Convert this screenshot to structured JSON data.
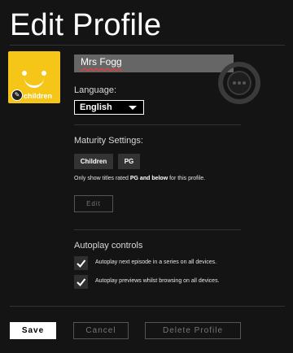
{
  "page": {
    "title": "Edit Profile"
  },
  "profile": {
    "avatar_brand": "children",
    "avatar_color": "#f5c518",
    "name_value": "Mrs Fogg"
  },
  "language": {
    "label": "Language:",
    "selected": "English"
  },
  "maturity": {
    "label": "Maturity Settings:",
    "chips": [
      "Children",
      "PG"
    ],
    "note_prefix": "Only show titles rated ",
    "note_bold": "PG and below",
    "note_suffix": " for this profile.",
    "edit_label": "Edit"
  },
  "autoplay": {
    "label": "Autoplay controls",
    "options": [
      {
        "text": "Autoplay next episode in a series on all devices.",
        "checked": true
      },
      {
        "text": "Autoplay previews whilst browsing on all devices.",
        "checked": true
      }
    ]
  },
  "actions": {
    "save": "Save",
    "cancel": "Cancel",
    "delete": "Delete Profile"
  }
}
